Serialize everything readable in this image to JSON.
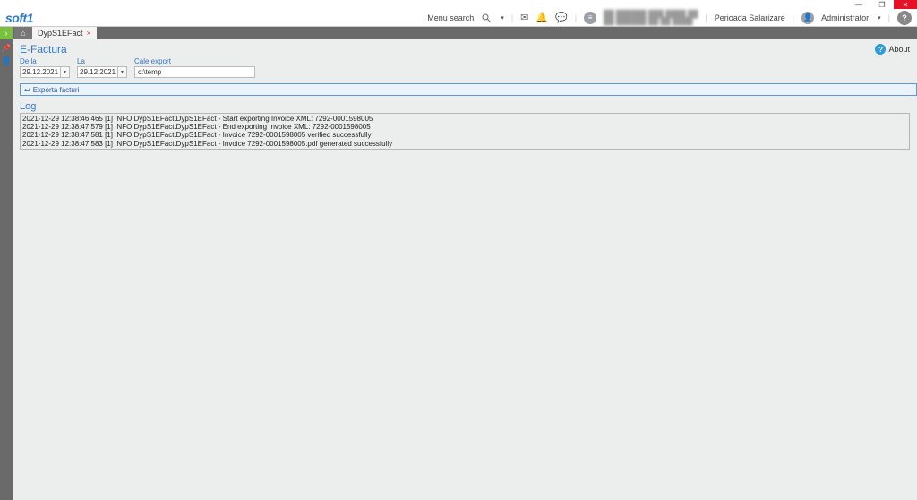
{
  "window_controls": {
    "minimize": "—",
    "maximize": "❐",
    "close": "✕"
  },
  "brand": "soft1",
  "header": {
    "menu_search": "Menu search",
    "perioada": "Perioada Salarizare",
    "admin": "Administrator",
    "masked_line1": "██ ██████ ███ ████ ██",
    "masked_line2": "██ ██████ ██ ██ ████"
  },
  "tabs": {
    "active": "DypS1EFact"
  },
  "page": {
    "title": "E-Factura",
    "about": "About",
    "de_la_label": "De la",
    "la_label": "La",
    "cale_label": "Cale export",
    "de_la_value": "29.12.2021",
    "la_value": "29.12.2021",
    "cale_value": "c:\\temp",
    "export_btn": "Exporta facturi",
    "log_label": "Log"
  },
  "log_lines": [
    "2021-12-29 12:38:46,465 [1] INFO  DypS1EFact.DypS1EFact - Start exporting Invoice XML: 7292-0001598005",
    "2021-12-29 12:38:47,579 [1] INFO  DypS1EFact.DypS1EFact - End exporting Invoice XML: 7292-0001598005",
    "2021-12-29 12:38:47,581 [1] INFO  DypS1EFact.DypS1EFact - Invoice 7292-0001598005 verified successfully",
    "2021-12-29 12:38:47,583 [1] INFO  DypS1EFact.DypS1EFact - Invoice 7292-0001598005.pdf generated successfully"
  ]
}
